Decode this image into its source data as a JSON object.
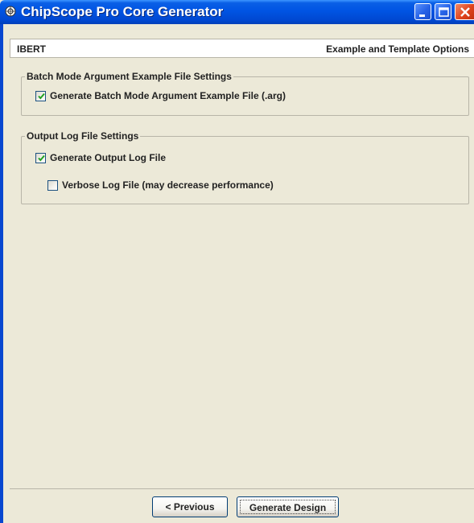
{
  "window": {
    "title": "ChipScope Pro Core Generator",
    "icon": "chipscope-app-icon",
    "controls": [
      "minimize-icon",
      "maximize-icon",
      "close-icon"
    ]
  },
  "header": {
    "left": "IBERT",
    "right": "Example and Template Options"
  },
  "batch_group": {
    "title": "Batch Mode Argument Example File Settings",
    "option": {
      "label": "Generate Batch Mode Argument Example File (.arg)",
      "checked": true
    }
  },
  "log_group": {
    "title": "Output Log File Settings",
    "options": [
      {
        "label": "Generate Output Log File",
        "checked": true
      },
      {
        "label": "Verbose Log File (may decrease performance)",
        "checked": false
      }
    ]
  },
  "buttons": {
    "previous": "< Previous",
    "generate": "Generate Design"
  },
  "colors": {
    "titlebar": "#0054e3",
    "window_bg": "#ece9d8",
    "close_button": "#e0441c"
  }
}
